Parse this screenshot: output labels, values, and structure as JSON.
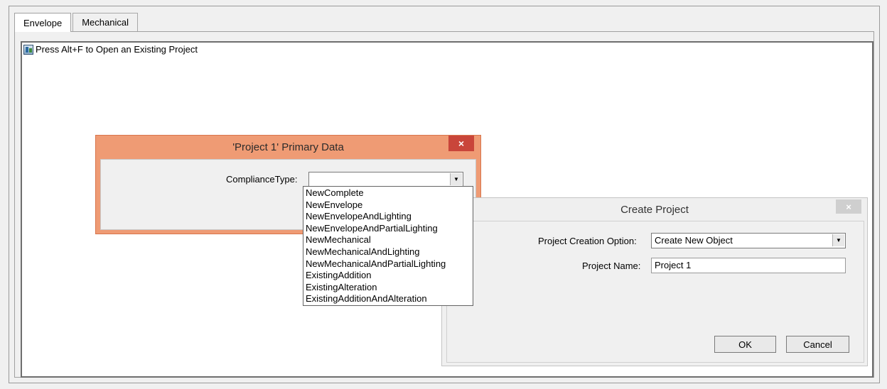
{
  "tabs": [
    {
      "label": "Envelope",
      "active": true
    },
    {
      "label": "Mechanical",
      "active": false
    }
  ],
  "hint": {
    "text": "Press Alt+F to Open an Existing Project",
    "icon": "project-open-icon"
  },
  "primary_dialog": {
    "title": "'Project 1' Primary Data",
    "close_glyph": "×",
    "compliance_label": "ComplianceType:",
    "compliance_value": "",
    "dropdown_arrow": "▼",
    "options": [
      "NewComplete",
      "NewEnvelope",
      "NewEnvelopeAndLighting",
      "NewEnvelopeAndPartialLighting",
      "NewMechanical",
      "NewMechanicalAndLighting",
      "NewMechanicalAndPartialLighting",
      "ExistingAddition",
      "ExistingAlteration",
      "ExistingAdditionAndAlteration"
    ],
    "title_bar_color": "#ef9b74",
    "close_color": "#c9453a"
  },
  "create_dialog": {
    "title": "Create Project",
    "close_glyph": "×",
    "option_label": "Project Creation Option:",
    "option_value": "Create New Object",
    "dropdown_arrow": "▼",
    "name_label": "Project Name:",
    "name_value": "Project 1",
    "ok_label": "OK",
    "cancel_label": "Cancel"
  }
}
